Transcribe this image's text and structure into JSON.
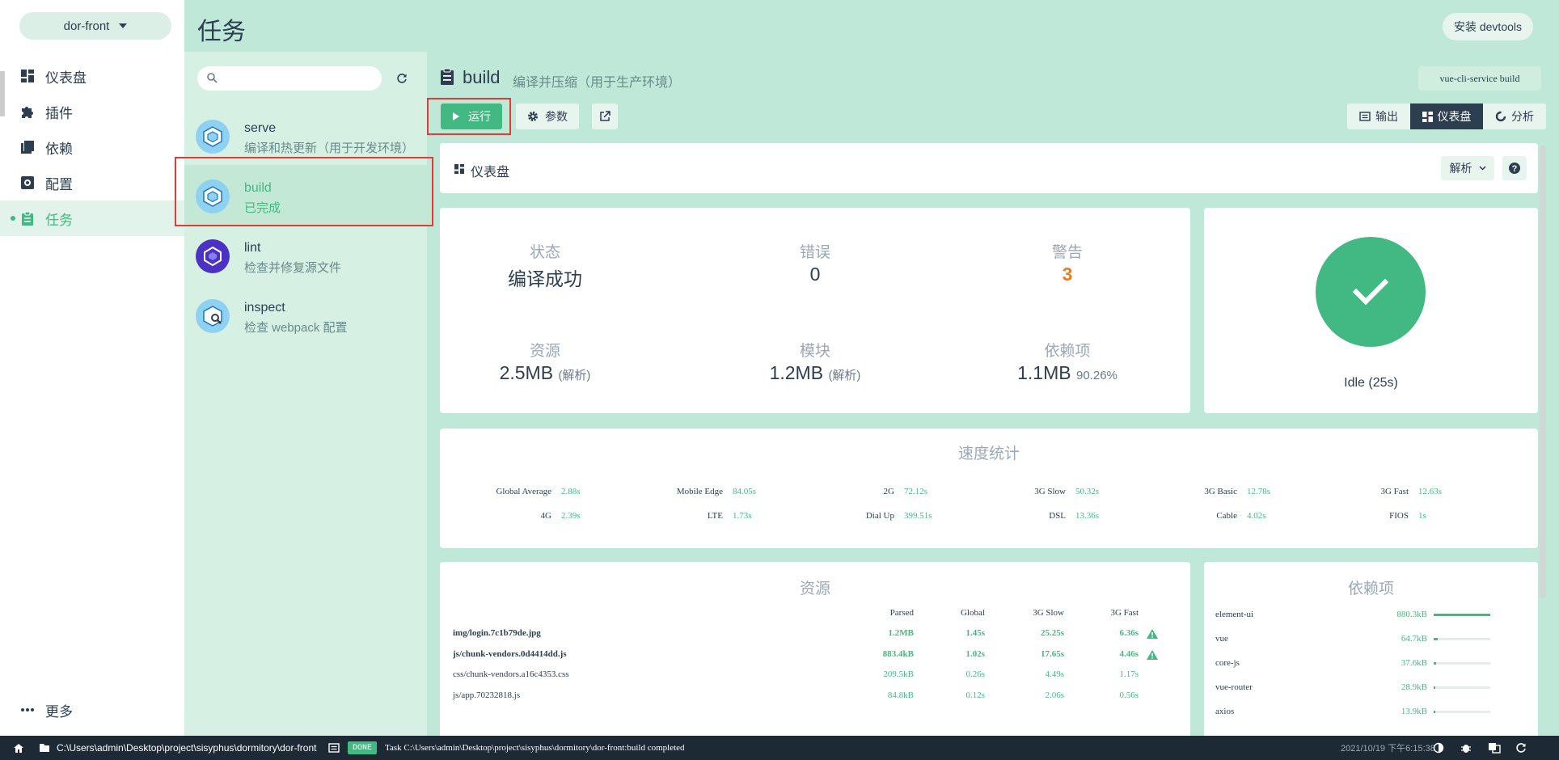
{
  "project": {
    "name": "dor-front"
  },
  "nav": {
    "items": [
      {
        "label": "仪表盘"
      },
      {
        "label": "插件"
      },
      {
        "label": "依赖"
      },
      {
        "label": "配置"
      },
      {
        "label": "任务"
      }
    ],
    "more_label": "更多",
    "active_index": 4
  },
  "header": {
    "title": "任务",
    "install_devtools_label": "安装 devtools"
  },
  "tasks": [
    {
      "name": "serve",
      "desc": "编译和热更新（用于开发环境）"
    },
    {
      "name": "build",
      "desc": "已完成"
    },
    {
      "name": "lint",
      "desc": "检查并修复源文件"
    },
    {
      "name": "inspect",
      "desc": "检查 webpack 配置"
    }
  ],
  "task": {
    "title": "build",
    "subtitle": "编译并压缩（用于生产环境）",
    "command": "vue-cli-service build",
    "run_label": "运行",
    "params_label": "参数",
    "views": {
      "output": "输出",
      "dashboard": "仪表盘",
      "analyze": "分析"
    }
  },
  "dashboard": {
    "title": "仪表盘",
    "mode_label": "解析",
    "stats": {
      "status_label": "状态",
      "status_value": "编译成功",
      "errors_label": "错误",
      "errors_value": "0",
      "warnings_label": "警告",
      "warnings_value": "3",
      "assets_label": "资源",
      "assets_value": "2.5MB",
      "assets_sub": "(解析)",
      "modules_label": "模块",
      "modules_value": "1.2MB",
      "modules_sub": "(解析)",
      "deps_label": "依赖项",
      "deps_value": "1.1MB",
      "deps_sub": "90.26%"
    },
    "idle_label": "Idle (25s)",
    "speed": {
      "title": "速度统计",
      "row1": [
        {
          "label": "Global Average",
          "value": "2.88s"
        },
        {
          "label": "Mobile Edge",
          "value": "84.05s"
        },
        {
          "label": "2G",
          "value": "72.12s"
        },
        {
          "label": "3G Slow",
          "value": "50.32s"
        },
        {
          "label": "3G Basic",
          "value": "12.78s"
        },
        {
          "label": "3G Fast",
          "value": "12.63s"
        }
      ],
      "row2": [
        {
          "label": "4G",
          "value": "2.39s"
        },
        {
          "label": "LTE",
          "value": "1.73s"
        },
        {
          "label": "Dial Up",
          "value": "399.51s"
        },
        {
          "label": "DSL",
          "value": "13.36s"
        },
        {
          "label": "Cable",
          "value": "4.02s"
        },
        {
          "label": "FIOS",
          "value": "1s"
        }
      ]
    },
    "assets": {
      "title": "资源",
      "headers": [
        "Parsed",
        "Global",
        "3G Slow",
        "3G Fast"
      ],
      "rows": [
        {
          "name": "img/login.7c1b79de.jpg",
          "parsed": "1.2MB",
          "global": "1.45s",
          "slow": "25.25s",
          "fast": "6.36s",
          "warn": true
        },
        {
          "name": "js/chunk-vendors.0d4414dd.js",
          "parsed": "883.4kB",
          "global": "1.02s",
          "slow": "17.65s",
          "fast": "4.46s",
          "warn": true
        },
        {
          "name": "css/chunk-vendors.a16c4353.css",
          "parsed": "209.5kB",
          "global": "0.26s",
          "slow": "4.49s",
          "fast": "1.17s",
          "warn": false
        },
        {
          "name": "js/app.70232818.js",
          "parsed": "84.8kB",
          "global": "0.12s",
          "slow": "2.06s",
          "fast": "0.56s",
          "warn": false
        }
      ]
    },
    "deps": {
      "title": "依赖项",
      "rows": [
        {
          "name": "element-ui",
          "size": "880.3kB",
          "ratio": 1.0
        },
        {
          "name": "vue",
          "size": "64.7kB",
          "ratio": 0.07
        },
        {
          "name": "core-js",
          "size": "37.6kB",
          "ratio": 0.04
        },
        {
          "name": "vue-router",
          "size": "28.9kB",
          "ratio": 0.03
        },
        {
          "name": "axios",
          "size": "13.9kB",
          "ratio": 0.016
        }
      ]
    }
  },
  "statusbar": {
    "path": "C:\\Users\\admin\\Desktop\\project\\sisyphus\\dormitory\\dor-front",
    "badge": "DONE",
    "message": "Task C:\\Users\\admin\\Desktop\\project\\sisyphus\\dormitory\\dor-front:build completed",
    "time": "2021/10/19 下午6:15:38"
  },
  "colors": {
    "accent": "#42b983",
    "dark": "#2c3e50",
    "warn": "#e67e22",
    "bg": "#bfe8d8"
  }
}
